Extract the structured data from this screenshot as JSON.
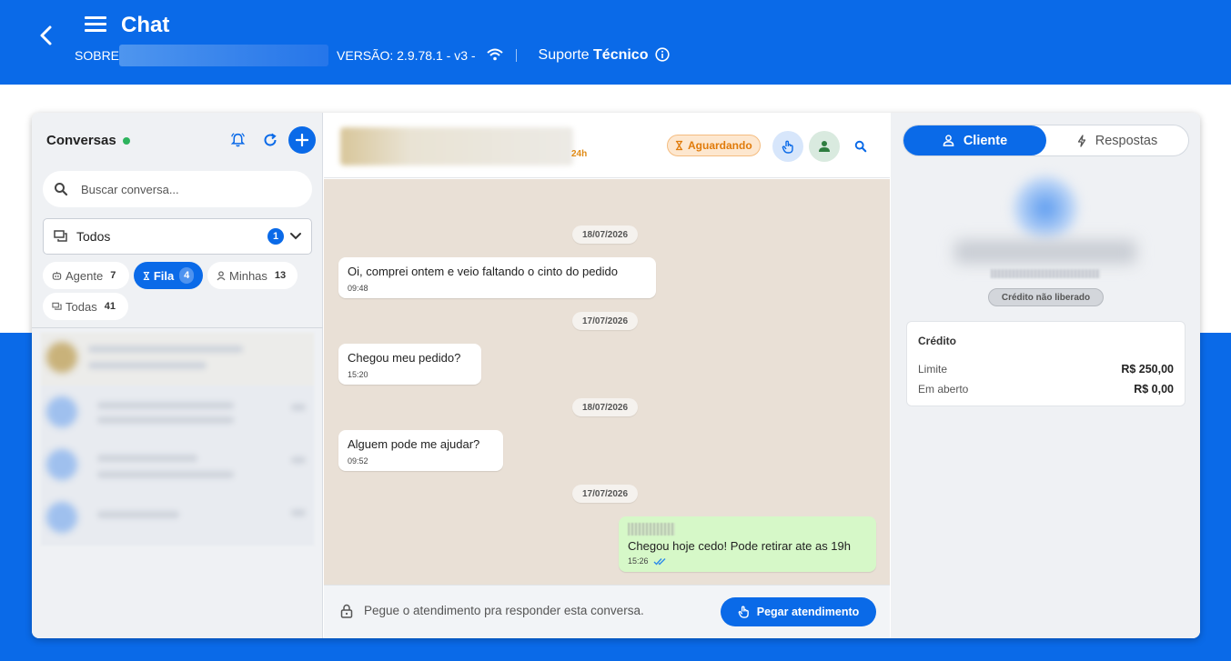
{
  "header": {
    "title": "Chat",
    "about_label": "SOBRE",
    "version_text": "VERSÃO:  2.9.78.1 - v3 -",
    "support_prefix": "Suporte ",
    "support_bold": "Técnico",
    "icons": [
      "back-arrow-icon",
      "menu-icon",
      "wifi-icon",
      "info-icon"
    ]
  },
  "sidebar": {
    "title": "Conversas",
    "search_placeholder": "Buscar conversa...",
    "filter_select": {
      "label": "Todos",
      "count": "1"
    },
    "chips": [
      {
        "label": "Agente",
        "count": "7",
        "icon": "robot-icon",
        "active": false
      },
      {
        "label": "Fila",
        "count": "4",
        "icon": "hourglass-icon",
        "active": true
      },
      {
        "label": "Minhas",
        "count": "13",
        "icon": "person-icon",
        "active": false
      },
      {
        "label": "Todas",
        "count": "41",
        "icon": "chat-icon",
        "active": false
      }
    ]
  },
  "chat": {
    "contact_time": "24h",
    "status": "Aguardando",
    "messages": [
      {
        "date": "18/07/2026",
        "text": "Oi, comprei ontem e veio faltando o cinto do pedido",
        "time": "09:48",
        "outgoing": false
      },
      {
        "date": "17/07/2026",
        "text": "Chegou meu pedido?",
        "time": "15:20",
        "outgoing": false
      },
      {
        "date": "18/07/2026",
        "text": "Alguem pode me ajudar?",
        "time": "09:52",
        "outgoing": false
      },
      {
        "date": "17/07/2026",
        "text": "Chegou hoje cedo! Pode retirar ate as 19h",
        "time": "15:26",
        "outgoing": true
      }
    ],
    "footer_text": "Pegue o atendimento pra responder esta conversa.",
    "take_button": "Pegar atendimento"
  },
  "panel": {
    "tab_client": "Cliente",
    "tab_answers": "Respostas",
    "credit_badge": "Crédito não liberado",
    "credit": {
      "title": "Crédito",
      "limit_label": "Limite",
      "limit_value": "R$ 250,00",
      "open_label": "Em aberto",
      "open_value": "R$ 0,00"
    }
  },
  "colors": {
    "brand": "#0a6ae8",
    "online": "#2db35d",
    "waiting": "#e07b0b",
    "outgoing_bubble": "#d6f8c8",
    "chat_bg": "#e9e0d6"
  }
}
